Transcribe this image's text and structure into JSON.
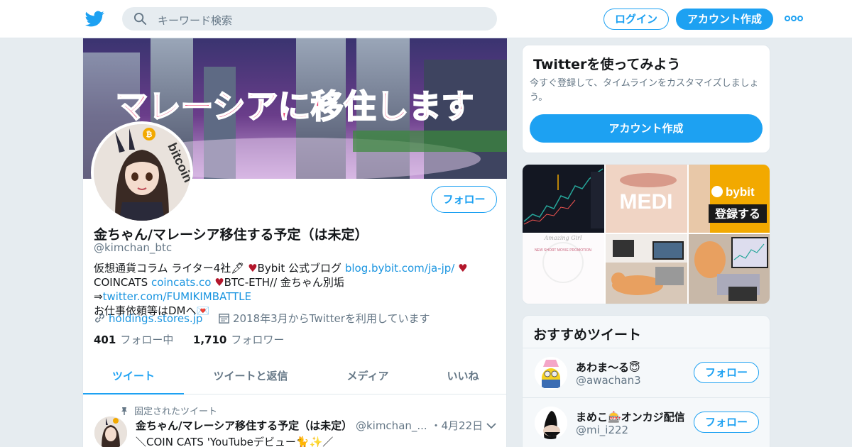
{
  "header": {
    "search_placeholder": "キーワード検索",
    "login_label": "ログイン",
    "signup_label": "アカウント作成",
    "brand_color": "#1da1f2"
  },
  "profile": {
    "banner_text": "マレーシアに移住します",
    "avatar_badge_text": "bitcoin",
    "follow_label": "フォロー",
    "name": "金ちゃん/マレーシア移住する予定（は未定）",
    "handle": "@kimchan_btc",
    "bio": {
      "line1_a": "仮想通貨コラム ライター4社🖋",
      "line1_b": "Bybit 公式ブログ",
      "line1_link": "blog.bybit.com/ja-jp/",
      "line2_a": "COINCATS",
      "line2_link1": "coincats.co",
      "line2_b": "BTC-ETH// 金ちゃん別垢⇒",
      "line2_link2": "twitter.com/FUMIKIMBATTLE",
      "line3": "お仕事依頼等はDMへ💌",
      "heart": "♥"
    },
    "website": "holdings.stores.jp",
    "joined": "2018年3月からTwitterを利用しています",
    "following_count": "401",
    "following_label": "フォロー中",
    "followers_count": "1,710",
    "followers_label": "フォロワー"
  },
  "tabs": [
    "ツイート",
    "ツイートと返信",
    "メディア",
    "いいね"
  ],
  "pinned_tweet": {
    "pin_label": "固定されたツイート",
    "name": "金ちゃん/マレーシア移住する予定（は未定）",
    "handle": "@kimchan_...",
    "date": "・4月22日",
    "text": "＼COIN CATS 'YouTubeデビュー🐈✨／"
  },
  "signup_card": {
    "title": "Twitterを使ってみよう",
    "desc": "今すぐ登録して、タイムラインをカスタマイズしましょう。",
    "button": "アカウント作成"
  },
  "media_tiles": {
    "t2_text": "MEDI",
    "t3_brand": "bybit",
    "t3_cta": "登録する",
    "t4_title": "Amazing Girl",
    "t4_sub": "NEW SHORT MOVIE PROMOTION"
  },
  "recommended": {
    "title": "おすすめツイート",
    "follow_label": "フォロー",
    "users": [
      {
        "name": "あわま〜る😇",
        "handle": "@awachan3"
      },
      {
        "name": "まめこ🎰オンカジ配信",
        "handle": "@mi_i222"
      }
    ]
  }
}
